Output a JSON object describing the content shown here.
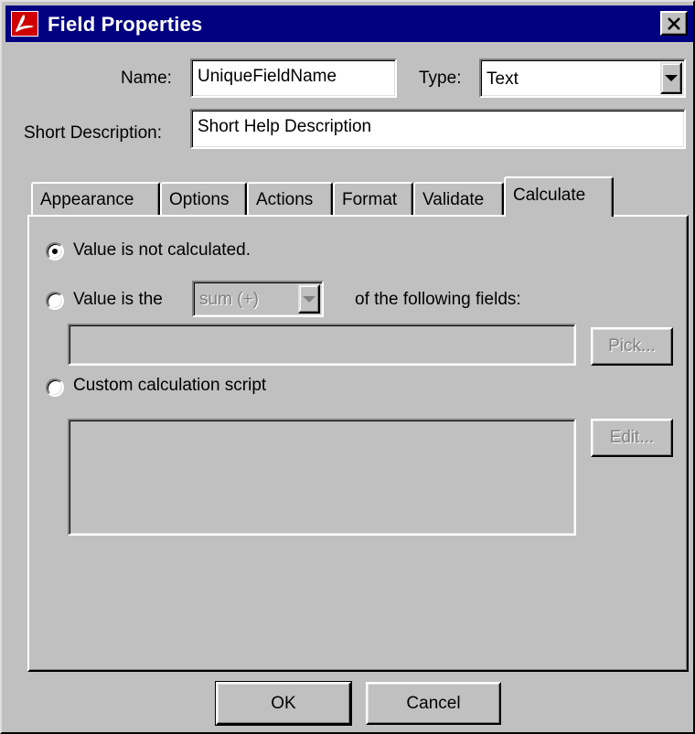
{
  "window": {
    "title": "Field Properties",
    "close_label": "×"
  },
  "fields": {
    "name_label": "Name:",
    "name_value": "UniqueFieldName",
    "type_label": "Type:",
    "type_value": "Text",
    "short_description_label": "Short Description:",
    "short_description_value": "Short Help Description"
  },
  "tabs": [
    {
      "label": "Appearance",
      "active": false
    },
    {
      "label": "Options",
      "active": false
    },
    {
      "label": "Actions",
      "active": false
    },
    {
      "label": "Format",
      "active": false
    },
    {
      "label": "Validate",
      "active": false
    },
    {
      "label": "Calculate",
      "active": true
    }
  ],
  "calculate": {
    "option_not_calculated": "Value is not calculated.",
    "option_value_is_the": "Value is the",
    "operation_value": "sum (+)",
    "of_following_fields": "of the following fields:",
    "fields_list_value": "",
    "pick_label": "Pick...",
    "option_custom_script": "Custom calculation script",
    "script_value": "",
    "edit_label": "Edit...",
    "selected_option": "not_calculated"
  },
  "footer": {
    "ok_label": "OK",
    "cancel_label": "Cancel"
  },
  "colors": {
    "titlebar": "#000080",
    "face": "#c0c0c0",
    "disabled_text": "#808080"
  },
  "icons": {
    "app": "acrobat-icon",
    "close": "close-icon"
  }
}
